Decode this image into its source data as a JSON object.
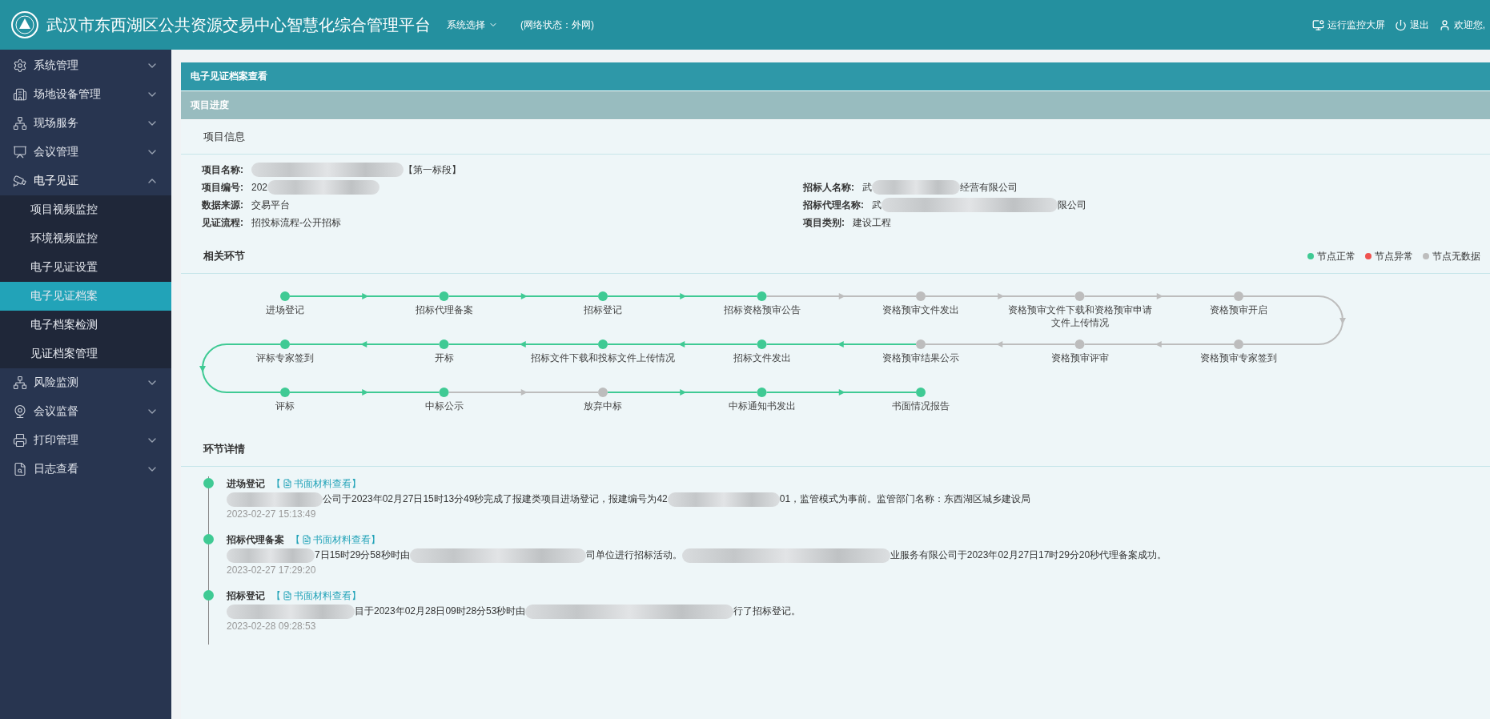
{
  "header": {
    "title": "武汉市东西湖区公共资源交易中心智慧化综合管理平台",
    "system_select": "系统选择",
    "network_status": "(网络状态：外网)",
    "actions": [
      "运行监控大屏",
      "退出",
      "欢迎您,"
    ]
  },
  "sidebar": {
    "items": [
      {
        "label": "系统管理",
        "expanded": false
      },
      {
        "label": "场地设备管理",
        "expanded": false
      },
      {
        "label": "现场服务",
        "expanded": false
      },
      {
        "label": "会议管理",
        "expanded": false
      },
      {
        "label": "电子见证",
        "expanded": true,
        "children": [
          {
            "label": "项目视频监控",
            "selected": false
          },
          {
            "label": "环境视频监控",
            "selected": false
          },
          {
            "label": "电子见证设置",
            "selected": false
          },
          {
            "label": "电子见证档案",
            "selected": true
          },
          {
            "label": "电子档案检测",
            "selected": false
          },
          {
            "label": "见证档案管理",
            "selected": false
          }
        ]
      },
      {
        "label": "风险监测",
        "expanded": false
      },
      {
        "label": "会议监督",
        "expanded": false
      },
      {
        "label": "打印管理",
        "expanded": false
      },
      {
        "label": "日志查看",
        "expanded": false
      }
    ]
  },
  "page_title": "电子见证档案查看",
  "progress_title": "项目进度",
  "info": {
    "title": "项目信息",
    "rows": [
      {
        "fields": [
          {
            "label": "项目名称:",
            "parts": [
              {
                "kind": "redacted"
              },
              {
                "kind": "text",
                "text": "【第一标段】"
              }
            ]
          }
        ]
      },
      {
        "fields": [
          {
            "label": "项目编号:",
            "parts": [
              {
                "kind": "text",
                "text": "202"
              },
              {
                "kind": "redacted"
              }
            ]
          },
          {
            "label": "招标人名称:",
            "parts": [
              {
                "kind": "text",
                "text": "武"
              },
              {
                "kind": "redacted"
              },
              {
                "kind": "text",
                "text": "经营有限公司"
              }
            ]
          }
        ]
      },
      {
        "fields": [
          {
            "label": "数据来源:",
            "parts": [
              {
                "kind": "text",
                "text": "交易平台"
              }
            ]
          },
          {
            "label": "招标代理名称:",
            "parts": [
              {
                "kind": "text",
                "text": "武"
              },
              {
                "kind": "redacted"
              },
              {
                "kind": "text",
                "text": "限公司"
              }
            ]
          }
        ]
      },
      {
        "fields": [
          {
            "label": "见证流程:",
            "parts": [
              {
                "kind": "text",
                "text": "招投标流程-公开招标"
              }
            ]
          },
          {
            "label": "项目类别:",
            "parts": [
              {
                "kind": "text",
                "text": "建设工程"
              }
            ]
          }
        ]
      }
    ]
  },
  "flow": {
    "title": "相关环节",
    "legend": [
      {
        "label": "节点正常",
        "color": "#3fca94"
      },
      {
        "label": "节点异常",
        "color": "#ef5350"
      },
      {
        "label": "节点无数据",
        "color": "#bdbdbd"
      }
    ],
    "rows": [
      {
        "nodes": [
          {
            "label": "进场登记",
            "color": "#3fca94"
          },
          {
            "label": "招标代理备案",
            "color": "#3fca94"
          },
          {
            "label": "招标登记",
            "color": "#3fca94"
          },
          {
            "label": "招标资格预审公告",
            "color": "#3fca94"
          },
          {
            "label": "资格预审文件发出",
            "color": "#bdbdbd"
          },
          {
            "label": "资格预审文件下载和资格预审申请文件上传情况",
            "color": "#bdbdbd"
          },
          {
            "label": "资格预审开启",
            "color": "#bdbdbd"
          }
        ]
      },
      {
        "nodes": [
          {
            "label": "评标专家签到",
            "color": "#3fca94"
          },
          {
            "label": "开标",
            "color": "#3fca94"
          },
          {
            "label": "招标文件下载和投标文件上传情况",
            "color": "#3fca94"
          },
          {
            "label": "招标文件发出",
            "color": "#3fca94"
          },
          {
            "label": "资格预审结果公示",
            "color": "#bdbdbd"
          },
          {
            "label": "资格预审评审",
            "color": "#bdbdbd"
          },
          {
            "label": "资格预审专家签到",
            "color": "#bdbdbd"
          }
        ]
      },
      {
        "nodes": [
          {
            "label": "评标",
            "color": "#3fca94"
          },
          {
            "label": "中标公示",
            "color": "#3fca94"
          },
          {
            "label": "放弃中标",
            "color": "#bdbdbd"
          },
          {
            "label": "中标通知书发出",
            "color": "#3fca94"
          },
          {
            "label": "书面情况报告",
            "color": "#3fca94"
          }
        ]
      }
    ]
  },
  "details": {
    "title": "环节详情",
    "items": [
      {
        "title": "进场登记",
        "link": {
          "open": "【",
          "label": "书面材料查看",
          "close": "】"
        },
        "parts": [
          {
            "kind": "redacted"
          },
          {
            "kind": "text",
            "text": "公司于2023年02月27日15时13分49秒完成了报建类项目进场登记，报建编号为42"
          },
          {
            "kind": "redacted"
          },
          {
            "kind": "text",
            "text": "01，监管模式为事前。监管部门名称：东西湖区"
          },
          {
            "kind": "text",
            "text": "城乡建设局"
          }
        ],
        "time": "2023-02-27 15:13:49"
      },
      {
        "title": "招标代理备案",
        "link": {
          "open": "【",
          "label": "书面材料查看",
          "close": "】"
        },
        "parts": [
          {
            "kind": "redacted"
          },
          {
            "kind": "text",
            "text": "7日15时29分58秒时由"
          },
          {
            "kind": "redacted"
          },
          {
            "kind": "text",
            "text": "司单位进行招标活动。"
          },
          {
            "kind": "redacted"
          },
          {
            "kind": "text",
            "text": "业服务有限公司于2023年02月27日17时29分20秒代理备案成功。"
          }
        ],
        "time": "2023-02-27 17:29:20"
      },
      {
        "title": "招标登记",
        "link": {
          "open": "【",
          "label": "书面材料查看",
          "close": "】"
        },
        "parts": [
          {
            "kind": "redacted"
          },
          {
            "kind": "text",
            "text": "目于2023年02月28日09时28分53秒时由"
          },
          {
            "kind": "redacted"
          },
          {
            "kind": "text",
            "text": "行了招标登记。"
          }
        ],
        "time": "2023-02-28 09:28:53"
      }
    ]
  }
}
